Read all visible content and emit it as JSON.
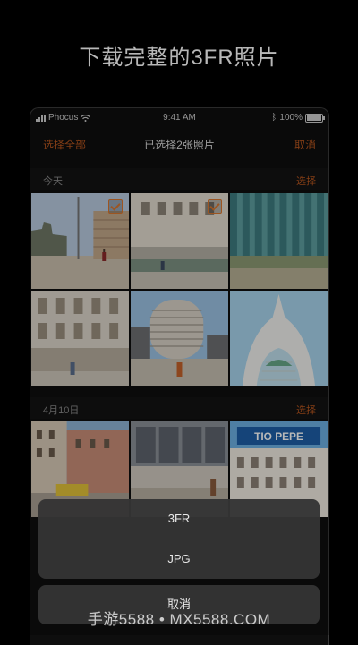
{
  "promo": {
    "title": "下载完整的3FR照片"
  },
  "status_bar": {
    "carrier": "Phocus",
    "time": "9:41 AM",
    "battery": "100%"
  },
  "navbar": {
    "select_all": "选择全部",
    "title": "已选择2张照片",
    "cancel": "取消"
  },
  "sections": [
    {
      "date": "今天",
      "select_label": "选择"
    },
    {
      "date": "4月10日",
      "select_label": "选择"
    }
  ],
  "photos_today": [
    {
      "icon": "plaza-photo",
      "selected": true
    },
    {
      "icon": "building-photo",
      "selected": true
    },
    {
      "icon": "facade-photo",
      "selected": false
    },
    {
      "icon": "street-photo",
      "selected": false
    },
    {
      "icon": "rotunda-photo",
      "selected": false
    },
    {
      "icon": "arch-photo",
      "selected": false
    }
  ],
  "photos_apr10": [
    {
      "icon": "street-photo",
      "selected": false
    },
    {
      "icon": "mall-photo",
      "selected": false
    },
    {
      "icon": "tio-pepe-photo",
      "selected": false
    }
  ],
  "photo_sign": "TIO PEPE",
  "action_sheet": {
    "options": [
      "3FR",
      "JPG"
    ],
    "cancel": "取消"
  },
  "watermark": "手游5588 • MX5588.COM",
  "colors": {
    "accent": "#b8561f",
    "check": "#d8762e",
    "sheet": "#343434",
    "background": "#000000"
  }
}
